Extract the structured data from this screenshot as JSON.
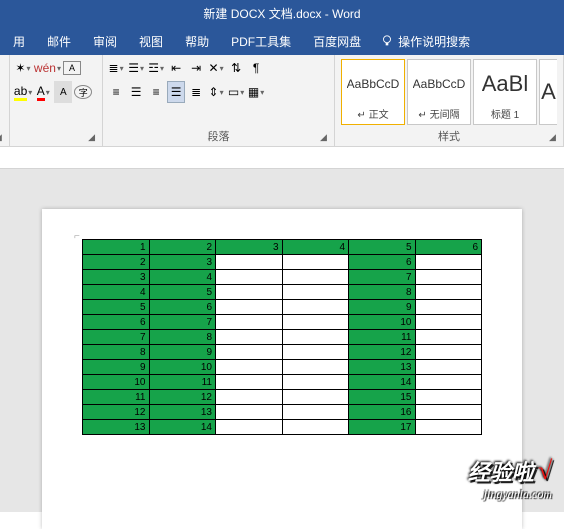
{
  "title": "新建 DOCX 文档.docx  -  Word",
  "menu": {
    "i0": "用",
    "i1": "邮件",
    "i2": "审阅",
    "i3": "视图",
    "i4": "帮助",
    "i5": "PDF工具集",
    "i6": "百度网盘",
    "tellme": "操作说明搜索"
  },
  "ribbon": {
    "font_label": "",
    "para_label": "段落",
    "styles_label": "样式"
  },
  "styles": {
    "s0": {
      "preview": "AaBbCcD",
      "name": "↵ 正文"
    },
    "s1": {
      "preview": "AaBbCcD",
      "name": "↵ 无间隔"
    },
    "s2": {
      "preview": "AaBl",
      "name": "标题 1"
    },
    "s3": {
      "preview": "A",
      "name": ""
    }
  },
  "watermark": {
    "main": "经验啦",
    "check": "√",
    "sub": "jingyanla.com"
  },
  "table": {
    "rows": [
      [
        {
          "v": "1",
          "g": 1
        },
        {
          "v": "2",
          "g": 1
        },
        {
          "v": "3",
          "g": 1
        },
        {
          "v": "4",
          "g": 1
        },
        {
          "v": "5",
          "g": 1
        },
        {
          "v": "6",
          "g": 1
        }
      ],
      [
        {
          "v": "2",
          "g": 1
        },
        {
          "v": "3",
          "g": 1
        },
        {
          "v": "",
          "g": 0
        },
        {
          "v": "",
          "g": 0
        },
        {
          "v": "6",
          "g": 1
        },
        {
          "v": "",
          "g": 0
        }
      ],
      [
        {
          "v": "3",
          "g": 1
        },
        {
          "v": "4",
          "g": 1
        },
        {
          "v": "",
          "g": 0
        },
        {
          "v": "",
          "g": 0
        },
        {
          "v": "7",
          "g": 1
        },
        {
          "v": "",
          "g": 0
        }
      ],
      [
        {
          "v": "4",
          "g": 1
        },
        {
          "v": "5",
          "g": 1
        },
        {
          "v": "",
          "g": 0
        },
        {
          "v": "",
          "g": 0
        },
        {
          "v": "8",
          "g": 1
        },
        {
          "v": "",
          "g": 0
        }
      ],
      [
        {
          "v": "5",
          "g": 1
        },
        {
          "v": "6",
          "g": 1
        },
        {
          "v": "",
          "g": 0
        },
        {
          "v": "",
          "g": 0
        },
        {
          "v": "9",
          "g": 1
        },
        {
          "v": "",
          "g": 0
        }
      ],
      [
        {
          "v": "6",
          "g": 1
        },
        {
          "v": "7",
          "g": 1
        },
        {
          "v": "",
          "g": 0
        },
        {
          "v": "",
          "g": 0
        },
        {
          "v": "10",
          "g": 1
        },
        {
          "v": "",
          "g": 0
        }
      ],
      [
        {
          "v": "7",
          "g": 1
        },
        {
          "v": "8",
          "g": 1
        },
        {
          "v": "",
          "g": 0
        },
        {
          "v": "",
          "g": 0
        },
        {
          "v": "11",
          "g": 1
        },
        {
          "v": "",
          "g": 0
        }
      ],
      [
        {
          "v": "8",
          "g": 1
        },
        {
          "v": "9",
          "g": 1
        },
        {
          "v": "",
          "g": 0
        },
        {
          "v": "",
          "g": 0
        },
        {
          "v": "12",
          "g": 1
        },
        {
          "v": "",
          "g": 0
        }
      ],
      [
        {
          "v": "9",
          "g": 1
        },
        {
          "v": "10",
          "g": 1
        },
        {
          "v": "",
          "g": 0
        },
        {
          "v": "",
          "g": 0
        },
        {
          "v": "13",
          "g": 1
        },
        {
          "v": "",
          "g": 0
        }
      ],
      [
        {
          "v": "10",
          "g": 1
        },
        {
          "v": "11",
          "g": 1
        },
        {
          "v": "",
          "g": 0
        },
        {
          "v": "",
          "g": 0
        },
        {
          "v": "14",
          "g": 1
        },
        {
          "v": "",
          "g": 0
        }
      ],
      [
        {
          "v": "11",
          "g": 1
        },
        {
          "v": "12",
          "g": 1
        },
        {
          "v": "",
          "g": 0
        },
        {
          "v": "",
          "g": 0
        },
        {
          "v": "15",
          "g": 1
        },
        {
          "v": "",
          "g": 0
        }
      ],
      [
        {
          "v": "12",
          "g": 1
        },
        {
          "v": "13",
          "g": 1
        },
        {
          "v": "",
          "g": 0
        },
        {
          "v": "",
          "g": 0
        },
        {
          "v": "16",
          "g": 1
        },
        {
          "v": "",
          "g": 0
        }
      ],
      [
        {
          "v": "13",
          "g": 1
        },
        {
          "v": "14",
          "g": 1
        },
        {
          "v": "",
          "g": 0
        },
        {
          "v": "",
          "g": 0
        },
        {
          "v": "17",
          "g": 1
        },
        {
          "v": "",
          "g": 0
        }
      ]
    ]
  }
}
